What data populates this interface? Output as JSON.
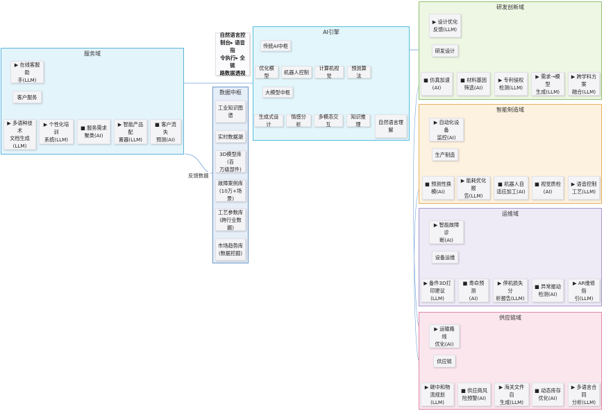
{
  "header": {
    "banner": "自然语言控\n制台▸ 语音指\n令执行▸ 全链\n路数据透视"
  },
  "service": {
    "title": "服务域",
    "top": "▶ 在线客服助\n手(LLM)",
    "mid": "客户服务",
    "leaves": [
      "▶ 多语种技术\n文档生成\n(LLM)",
      "▶ 个性化培训\n系统(LLM)",
      "■ 服务需求\n聚类(AI)",
      "▶ 智能产品配\n置器(LLM)",
      "■ 客户流失\n预测(AI)"
    ]
  },
  "engine": {
    "title": "AI引擎",
    "traditional": "传统AI中枢",
    "traditional_items": [
      "优化模型",
      "机器人控制",
      "计算机视觉",
      "预测算法"
    ],
    "large": "大模型中枢",
    "large_items": [
      "生成式设计",
      "情感分析",
      "多模态交互",
      "知识推理",
      "自然语言理\n解"
    ]
  },
  "data_hub": {
    "title": "数据中枢",
    "items": [
      "工业知识图\n谱",
      "实时数据湖",
      "3D模型库(百\n万级部件)",
      "故障案例库\n(10万+场景)",
      "工艺参数库\n(跨行业数据)",
      "市场趋势库\n(数据挖掘)"
    ]
  },
  "feedback_label": "反馈数据",
  "rd": {
    "title": "研发创新域",
    "top": "▶ 设计优化\n反馈(LLM)",
    "mid": "研发设计",
    "leaves": [
      "■ 仿真加速\n(AI)",
      "■ 材料基因\n筛选(AI)",
      "▶ 专利侵权\n检测(LLM)",
      "▶ 需求→模型\n生成(LLM)",
      "▶ 跨学科方案\n融合(LLM)"
    ]
  },
  "mfg": {
    "title": "智能制造域",
    "top": "▶ 自动化设备\n监控(AI)",
    "mid": "生产制造",
    "leaves": [
      "■ 预测性换\n模(AI)",
      "▶ 能耗优化报\n告(LLM)",
      "■ 机器人自\n适应加工(AI)",
      "■ 视觉质检\n(AI)",
      "▶ 语音控制\n工艺(LLM)"
    ]
  },
  "ops": {
    "title": "运维域",
    "top": "▶ 智能故障诊\n断(AI)",
    "mid": "设备运维",
    "leaves": [
      "▶ 备件3D打\n印建议(LLM)",
      "■ 寿命预测\n(AI)",
      "▶ 停机损失分\n析报告(LLM)",
      "■ 异常振动\n检测(AI)",
      "▶ AR维修指\n引(LLM)"
    ]
  },
  "supply": {
    "title": "供应链域",
    "top": "▶ 运输路线\n优化(AI)",
    "mid": "供应链",
    "leaves": [
      "▶ 碳中和物\n流规划(LLM)",
      "■ 供应商风\n险预警(AI)",
      "▶ 海关文件自\n生成(LLM)",
      "■ 动态库存\n优化(AI)",
      "▶ 多语言合同\n分析(LLM)"
    ]
  },
  "colors": {
    "service_bg": "#e4f4fb",
    "service_border": "#5cb4dd",
    "engine_bg": "#e2f6fb",
    "engine_border": "#54bedd",
    "data_bg": "#e6eef8",
    "data_border": "#6a96c8",
    "rd_bg": "#eef6e4",
    "rd_border": "#8ec070",
    "mfg_bg": "#fdf2e0",
    "mfg_border": "#e5b060",
    "ops_bg": "#eeeaf6",
    "ops_border": "#a896cc",
    "supply_bg": "#fbe6ee",
    "supply_border": "#de86a6",
    "wire": "#6fa0d8",
    "wire_gold": "#e8b84a",
    "wire_cyan": "#3cc0e0"
  }
}
